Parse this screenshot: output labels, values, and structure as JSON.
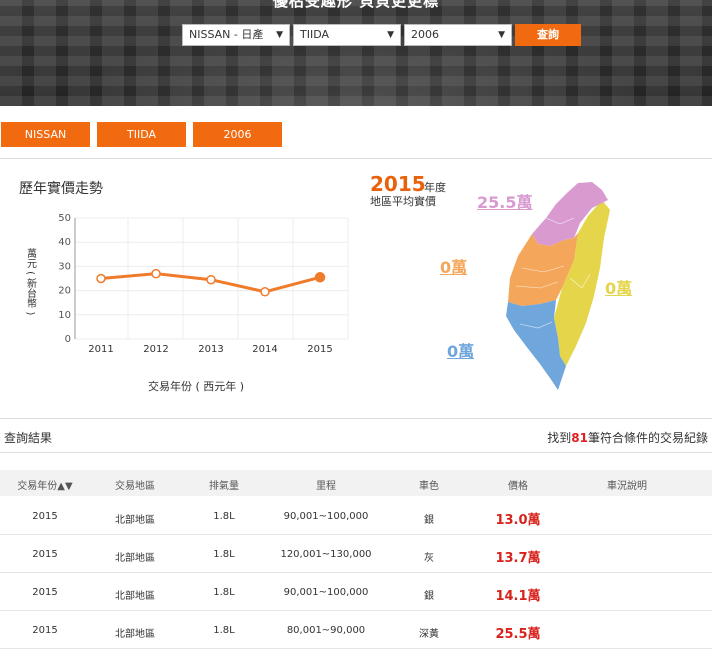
{
  "hero": {
    "title": "優枯受趣形 貝貝更更標",
    "brand_select": "NISSAN - 日產",
    "model_select": "TIIDA",
    "year_select": "2006",
    "search_button": "查詢"
  },
  "tags": [
    "NISSAN",
    "TIIDA",
    "2006"
  ],
  "trend": {
    "title": "歷年實價走勢"
  },
  "chart_data": {
    "type": "line",
    "title": "歷年實價走勢",
    "xlabel": "交易年份 ( 西元年 )",
    "ylabel": "萬元 ( 新台幣 )",
    "categories": [
      "2011",
      "2012",
      "2013",
      "2014",
      "2015"
    ],
    "values": [
      25,
      27,
      24.5,
      19.5,
      25.5
    ],
    "ylim": [
      0,
      50
    ],
    "yticks": [
      0,
      10,
      20,
      30,
      40,
      50
    ],
    "grid": true,
    "color": "#f07b2a"
  },
  "map": {
    "year": "2015",
    "year_unit": "年度",
    "subtitle": "地區平均實價",
    "regions": [
      {
        "name": "north",
        "label": "25.5萬",
        "color": "#d99ad0"
      },
      {
        "name": "central",
        "label": "0萬",
        "color": "#f4a75a"
      },
      {
        "name": "east",
        "label": "0萬",
        "color": "#e5d54a"
      },
      {
        "name": "south",
        "label": "0萬",
        "color": "#6fa6dc"
      }
    ]
  },
  "results": {
    "title": "查詢結果",
    "count_prefix": "找到",
    "count": "81",
    "count_suffix": "筆符合條件的交易紀錄",
    "headers": [
      "交易年份▲▼",
      "交易地區",
      "排氣量",
      "里程",
      "車色",
      "價格",
      "車況說明"
    ],
    "rows": [
      [
        "2015",
        "北部地區",
        "1.8L",
        "90,001~100,000",
        "銀",
        "13.0萬",
        ""
      ],
      [
        "2015",
        "北部地區",
        "1.8L",
        "120,001~130,000",
        "灰",
        "13.7萬",
        ""
      ],
      [
        "2015",
        "北部地區",
        "1.8L",
        "90,001~100,000",
        "銀",
        "14.1萬",
        ""
      ],
      [
        "2015",
        "北部地區",
        "1.8L",
        "80,001~90,000",
        "深黃",
        "25.5萬",
        ""
      ]
    ]
  }
}
